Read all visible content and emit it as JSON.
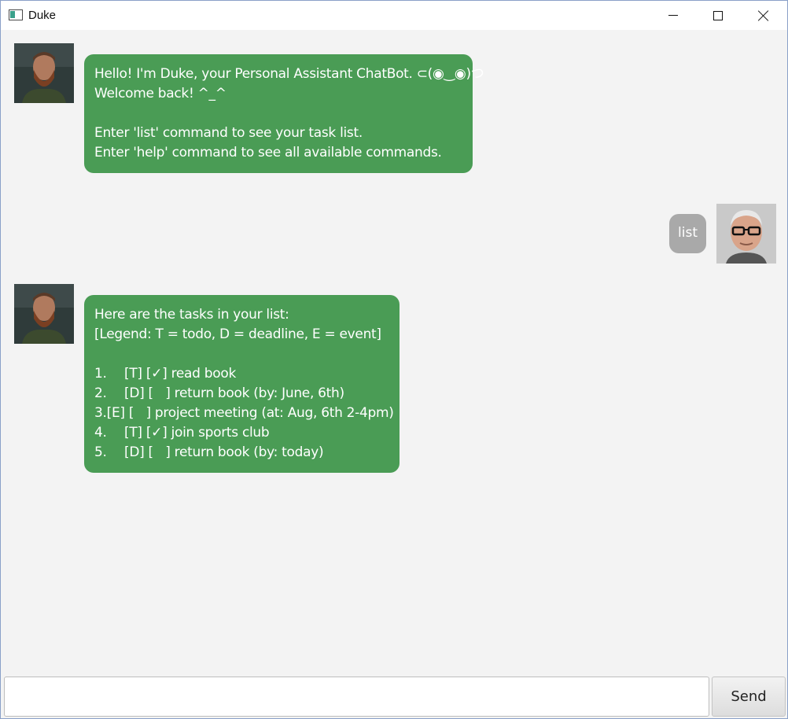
{
  "window": {
    "title": "Duke"
  },
  "chat": {
    "messages": [
      {
        "sender": "bot",
        "lines": [
          "Hello! I'm Duke, your Personal Assistant ChatBot. ⊂(◉‿◉)つ",
          "Welcome back! ^_^",
          "",
          "Enter 'list' command to see your task list.",
          "Enter 'help' command to see all available commands."
        ]
      },
      {
        "sender": "user",
        "text": "list"
      },
      {
        "sender": "bot",
        "header_lines": [
          "Here are the tasks in your list:",
          "[Legend: T = todo, D = deadline, E = event]"
        ],
        "tasks": [
          {
            "num": "1.",
            "text": "[T] [✓] read book"
          },
          {
            "num": "2.",
            "text": "[D] [   ] return book (by: June, 6th)"
          },
          {
            "num": "3.",
            "text": "[E] [   ] project meeting (at: Aug, 6th 2-4pm)"
          },
          {
            "num": "4.",
            "text": "[T] [✓] join sports club"
          },
          {
            "num": "5.",
            "text": "[D] [   ] return book (by: today)"
          }
        ]
      }
    ]
  },
  "input": {
    "value": "",
    "placeholder": ""
  },
  "send_label": "Send",
  "colors": {
    "bot_bubble": "#4a9c55",
    "user_bubble": "#a9a9a9",
    "background": "#f3f3f3"
  },
  "icons": {
    "bot_avatar": "bearded-man-avatar",
    "user_avatar": "glasses-man-avatar"
  }
}
